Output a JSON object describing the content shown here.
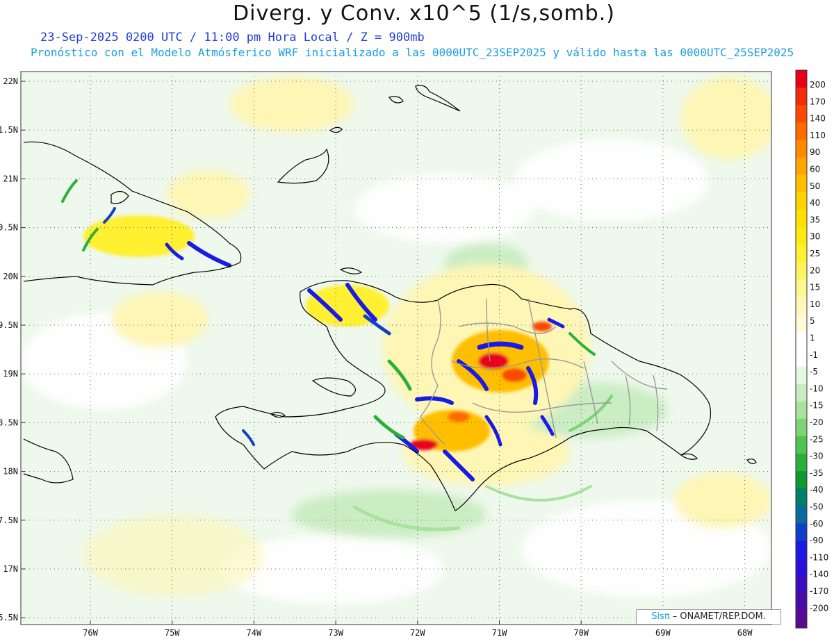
{
  "header": {
    "title": "Diverg. y Conv. x10^5 (1/s,somb.)",
    "subtitle_line1": "23-Sep-2025 0200 UTC / 11:00 pm Hora Local / Z = 900mb",
    "subtitle_line2": "Pronóstico con el Modelo Atmósferico WRF inicializado a las 0000UTC_23SEP2025 y válido hasta las  0000UTC_25SEP2025"
  },
  "map": {
    "lat_labels": [
      "22N",
      "1.5N",
      "21N",
      "0.5N",
      "20N",
      "9.5N",
      "19N",
      "8.5N",
      "18N",
      "7.5N",
      "17N",
      "6.5N"
    ],
    "lon_labels": [
      "76W",
      "75W",
      "74W",
      "73W",
      "72W",
      "71W",
      "70W",
      "69W",
      "68W"
    ]
  },
  "colorbar": {
    "labels": [
      "200",
      "170",
      "140",
      "110",
      "90",
      "60",
      "50",
      "40",
      "35",
      "30",
      "25",
      "20",
      "15",
      "10",
      "5",
      "1",
      "-1",
      "-5",
      "-10",
      "-15",
      "-20",
      "-25",
      "-30",
      "-35",
      "-40",
      "-50",
      "-60",
      "-90",
      "-110",
      "-140",
      "-170",
      "-200"
    ],
    "colors": [
      "#e8001a",
      "#f52a0a",
      "#fb4a00",
      "#fd6a00",
      "#ff8a00",
      "#ffa500",
      "#ffbf00",
      "#ffd200",
      "#ffe000",
      "#ffea10",
      "#fff030",
      "#fff460",
      "#fff690",
      "#fff8b8",
      "#fffbd8",
      "#ffffff",
      "#ffffff",
      "#e6f7e4",
      "#c8ecc0",
      "#a8e29e",
      "#7cd476",
      "#4fc44e",
      "#2ab03a",
      "#0e9830",
      "#00806a",
      "#0a6aa0",
      "#1040c8",
      "#1a1ae6",
      "#2a10d8",
      "#3a0ec0",
      "#4a0aa8",
      "#5a0a90"
    ]
  },
  "credit": {
    "brand": "Sisπ",
    "org": " – ONAMET/REP.DOM."
  }
}
